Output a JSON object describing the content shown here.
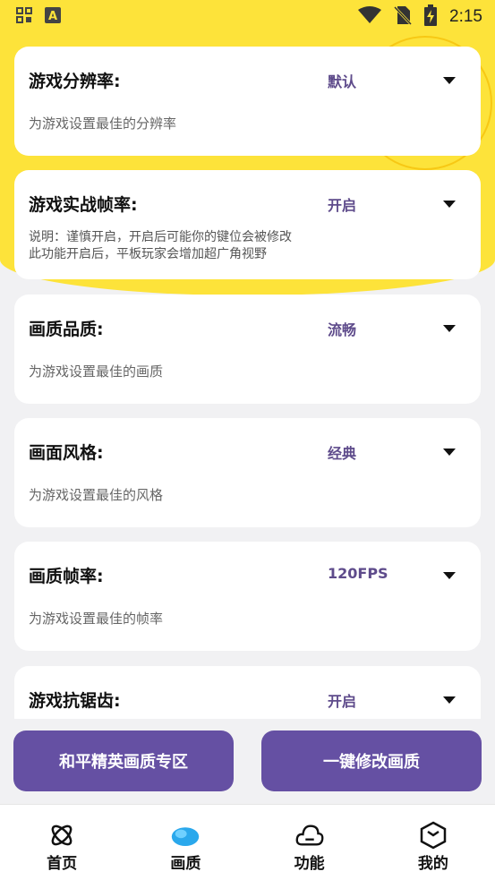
{
  "status_bar": {
    "time": "2:15"
  },
  "settings": [
    {
      "title": "游戏分辨率:",
      "value": "默认",
      "desc": "为游戏设置最佳的分辨率"
    },
    {
      "title": "游戏实战帧率:",
      "value": "开启",
      "desc_lines": [
        "说明：谨慎开启，开启后可能你的键位会被修改",
        "此功能开启后，平板玩家会增加超广角视野"
      ]
    },
    {
      "title": "画质品质:",
      "value": "流畅",
      "desc": "为游戏设置最佳的画质"
    },
    {
      "title": "画面风格:",
      "value": "经典",
      "desc": "为游戏设置最佳的风格"
    },
    {
      "title": "画质帧率:",
      "value": "120FPS",
      "desc": "为游戏设置最佳的帧率"
    },
    {
      "title": "游戏抗锯齿:",
      "value": "开启"
    }
  ],
  "actions": {
    "left_label": "和平精英画质专区",
    "right_label": "一键修改画质"
  },
  "nav": [
    {
      "label": "首页",
      "icon": "atom-icon"
    },
    {
      "label": "画质",
      "icon": "cloud-filled-icon",
      "active": true
    },
    {
      "label": "功能",
      "icon": "cloud-icon"
    },
    {
      "label": "我的",
      "icon": "box-icon"
    }
  ],
  "colors": {
    "accent": "#6550a3",
    "header_yellow": "#fde33a",
    "value_text": "#5e4b8b"
  }
}
